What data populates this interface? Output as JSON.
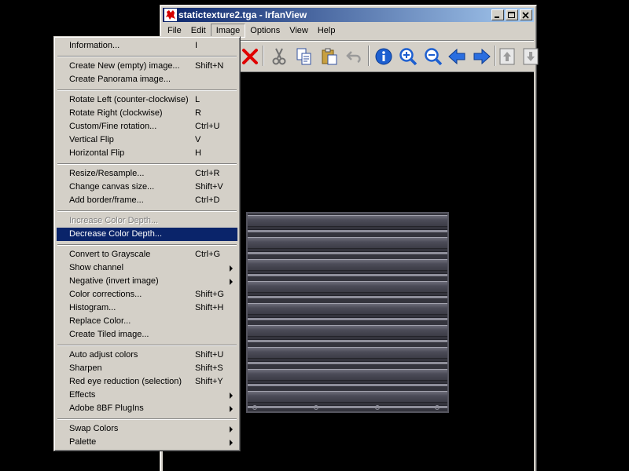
{
  "window": {
    "title": "statictexture2.tga - IrfanView",
    "icon": "irfanview-red-cat-icon",
    "title_color_start": "#0a246a",
    "title_color_end": "#a6caf0"
  },
  "menubar": {
    "items": [
      {
        "label": "File"
      },
      {
        "label": "Edit"
      },
      {
        "label": "Image",
        "open": true
      },
      {
        "label": "Options"
      },
      {
        "label": "View"
      },
      {
        "label": "Help"
      }
    ]
  },
  "toolbar": {
    "icons": [
      "delete-icon",
      "cut-icon",
      "copy-icon",
      "paste-icon",
      "undo-icon",
      "info-icon",
      "zoom-in-icon",
      "zoom-out-icon",
      "previous-icon",
      "next-icon",
      "first-page-icon",
      "last-page-icon"
    ]
  },
  "image_menu": {
    "highlight_color": "#0a246a",
    "items": {
      "information": {
        "label": "Information...",
        "shortcut": "I"
      },
      "create_new": {
        "label": "Create New (empty) image...",
        "shortcut": "Shift+N"
      },
      "create_panorama": {
        "label": "Create Panorama image..."
      },
      "rotate_left": {
        "label": "Rotate Left (counter-clockwise)",
        "shortcut": "L"
      },
      "rotate_right": {
        "label": "Rotate Right (clockwise)",
        "shortcut": "R"
      },
      "custom_rotation": {
        "label": "Custom/Fine rotation...",
        "shortcut": "Ctrl+U"
      },
      "vertical_flip": {
        "label": "Vertical Flip",
        "shortcut": "V"
      },
      "horizontal_flip": {
        "label": "Horizontal Flip",
        "shortcut": "H"
      },
      "resize": {
        "label": "Resize/Resample...",
        "shortcut": "Ctrl+R"
      },
      "canvas_size": {
        "label": "Change canvas size...",
        "shortcut": "Shift+V"
      },
      "add_border": {
        "label": "Add border/frame...",
        "shortcut": "Ctrl+D"
      },
      "increase_depth": {
        "label": "Increase Color Depth...",
        "disabled": true
      },
      "decrease_depth": {
        "label": "Decrease Color Depth...",
        "highlighted": true
      },
      "grayscale": {
        "label": "Convert to Grayscale",
        "shortcut": "Ctrl+G"
      },
      "show_channel": {
        "label": "Show channel",
        "submenu": true
      },
      "negative": {
        "label": "Negative (invert image)",
        "submenu": true
      },
      "color_corrections": {
        "label": "Color corrections...",
        "shortcut": "Shift+G"
      },
      "histogram": {
        "label": "Histogram...",
        "shortcut": "Shift+H"
      },
      "replace_color": {
        "label": "Replace Color..."
      },
      "tiled_image": {
        "label": "Create Tiled image..."
      },
      "auto_adjust": {
        "label": "Auto adjust colors",
        "shortcut": "Shift+U"
      },
      "sharpen": {
        "label": "Sharpen",
        "shortcut": "Shift+S"
      },
      "red_eye": {
        "label": "Red eye reduction (selection)",
        "shortcut": "Shift+Y"
      },
      "effects": {
        "label": "Effects",
        "submenu": true
      },
      "plugins": {
        "label": "Adobe 8BF PlugIns",
        "submenu": true
      },
      "swap_colors": {
        "label": "Swap Colors",
        "submenu": true
      },
      "palette": {
        "label": "Palette",
        "submenu": true
      }
    }
  }
}
